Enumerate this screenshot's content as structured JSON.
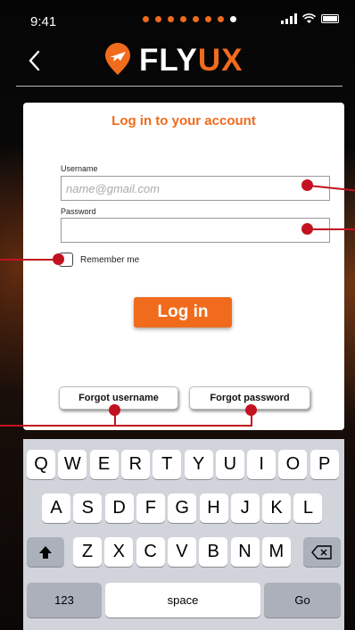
{
  "status_bar": {
    "time": "9:41"
  },
  "header": {
    "logo_fly": "FLY",
    "logo_ux": "UX",
    "brand_color": "#f06b1c"
  },
  "card": {
    "title": "Log in to your account",
    "username_label": "Username",
    "username_placeholder": "name@gmail.com",
    "password_label": "Password",
    "remember_label": "Remember me",
    "login_label": "Log in",
    "forgot_username": "Forgot username",
    "forgot_password": "Forgot password"
  },
  "keyboard": {
    "row1": [
      "Q",
      "W",
      "E",
      "R",
      "T",
      "Y",
      "U",
      "I",
      "O",
      "P"
    ],
    "row2": [
      "A",
      "S",
      "D",
      "F",
      "G",
      "H",
      "J",
      "K",
      "L"
    ],
    "row3": [
      "Z",
      "X",
      "C",
      "V",
      "B",
      "N",
      "M"
    ],
    "numbers_label": "123",
    "space_label": "space",
    "go_label": "Go"
  },
  "annotation_color": "#c3121f"
}
